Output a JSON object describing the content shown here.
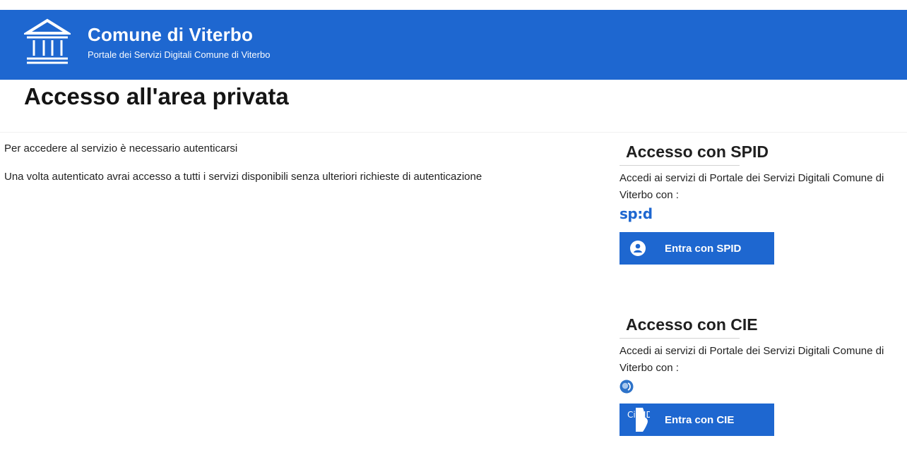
{
  "header": {
    "title": "Comune di Viterbo",
    "subtitle": "Portale dei Servizi Digitali Comune di Viterbo",
    "background_color": "#1e67d0",
    "logo_icon": "town-hall-icon"
  },
  "page": {
    "title": "Accesso all'area privata"
  },
  "intro": {
    "line1": "Per accedere al servizio è necessario autenticarsi",
    "line2": "Una volta autenticato avrai accesso a tutti i servizi disponibili senza ulteriori richieste di autenticazione"
  },
  "spid": {
    "heading": "Accesso con SPID",
    "text": "Accedi ai servizi di Portale dei Servizi Digitali Comune di Viterbo con :",
    "logo_text": "sp:d",
    "button_label": "Entra con SPID",
    "button_icon": "user-icon"
  },
  "cie": {
    "heading": "Accesso con CIE",
    "text": "Accedi ai servizi di Portale dei Servizi Digitali Comune di Viterbo con :",
    "logo_icon": "cie-icon",
    "button_label": "Entra con CIE",
    "button_icon": "cie-id-icon",
    "button_icon_text": "Cie ID"
  },
  "colors": {
    "accent": "#1e67d0"
  }
}
